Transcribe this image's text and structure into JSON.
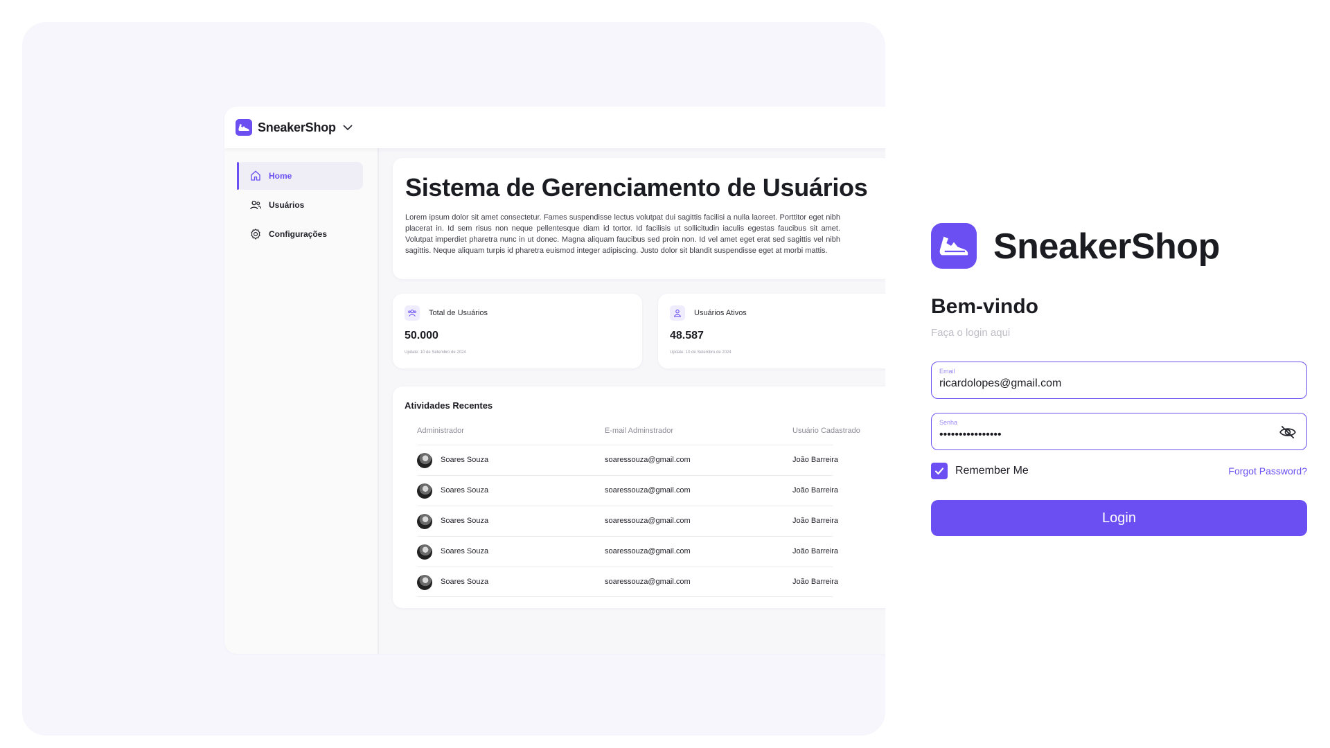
{
  "brand": {
    "name": "SneakerShop"
  },
  "sidebar": {
    "items": [
      {
        "label": "Home",
        "icon": "home-icon"
      },
      {
        "label": "Usuários",
        "icon": "users-icon"
      },
      {
        "label": "Configurações",
        "icon": "gear-icon"
      }
    ]
  },
  "hero": {
    "title": "Sistema de Gerenciamento de Usuários",
    "text": "Lorem ipsum dolor sit amet consectetur. Fames suspendisse lectus volutpat dui sagittis facilisi a nulla laoreet. Porttitor eget nibh placerat in. Id sem risus non neque pellentesque diam id tortor. Id facilisis ut sollicitudin iaculis egestas faucibus sit amet. Volutpat imperdiet pharetra nunc in ut donec. Magna aliquam faucibus sed proin non. Id vel amet eget erat sed sagittis vel nibh sagittis. Neque aliquam turpis id pharetra euismod integer adipiscing. Justo dolor sit blandit suspendisse eget at morbi mattis."
  },
  "stats": [
    {
      "label": "Total de Usuários",
      "value": "50.000",
      "updated": "Update: 10 de Setembro de 2024"
    },
    {
      "label": "Usuários Ativos",
      "value": "48.587",
      "updated": "Update: 10 de Setembro de 2024"
    }
  ],
  "activities": {
    "title": "Atividades Recentes",
    "columns": [
      "Administrador",
      "E-mail Adminstrador",
      "Usuário Cadastrado"
    ],
    "rows": [
      {
        "admin": "Soares Souza",
        "email": "soaressouza@gmail.com",
        "user": "João Barreira"
      },
      {
        "admin": "Soares Souza",
        "email": "soaressouza@gmail.com",
        "user": "João Barreira"
      },
      {
        "admin": "Soares Souza",
        "email": "soaressouza@gmail.com",
        "user": "João Barreira"
      },
      {
        "admin": "Soares Souza",
        "email": "soaressouza@gmail.com",
        "user": "João Barreira"
      },
      {
        "admin": "Soares Souza",
        "email": "soaressouza@gmail.com",
        "user": "João Barreira"
      }
    ]
  },
  "login": {
    "brand": "SneakerShop",
    "title": "Bem-vindo",
    "subtitle": "Faça o login aqui",
    "email_label": "Email",
    "email_value": "ricardolopes@gmail.com",
    "password_label": "Senha",
    "password_value": "••••••••••••••••",
    "remember_label": "Remember Me",
    "remember_checked": true,
    "forgot_label": "Forgot Password?",
    "button_label": "Login"
  },
  "colors": {
    "accent": "#6b4ff2",
    "panel_bg": "#f7f6fd"
  }
}
